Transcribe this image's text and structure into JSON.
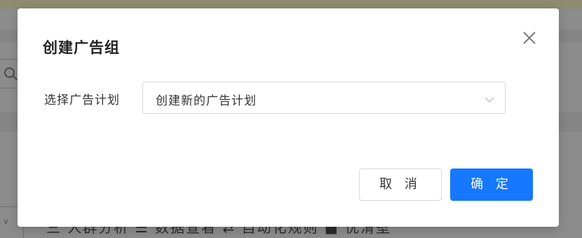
{
  "background": {
    "bottom_text": "三 人群分析   ☰ 数据查看   ⇄ 自动化规则   ■   优滑壁"
  },
  "modal": {
    "title": "创建广告组",
    "close_icon": "close-icon",
    "form": {
      "label": "选择广告计划",
      "select_value": "创建新的广告计划",
      "select_icon": "chevron-down-icon"
    },
    "buttons": {
      "cancel": "取 消",
      "ok": "确 定"
    },
    "colors": {
      "primary": "#1677ff",
      "border": "#d9d9d9"
    }
  }
}
